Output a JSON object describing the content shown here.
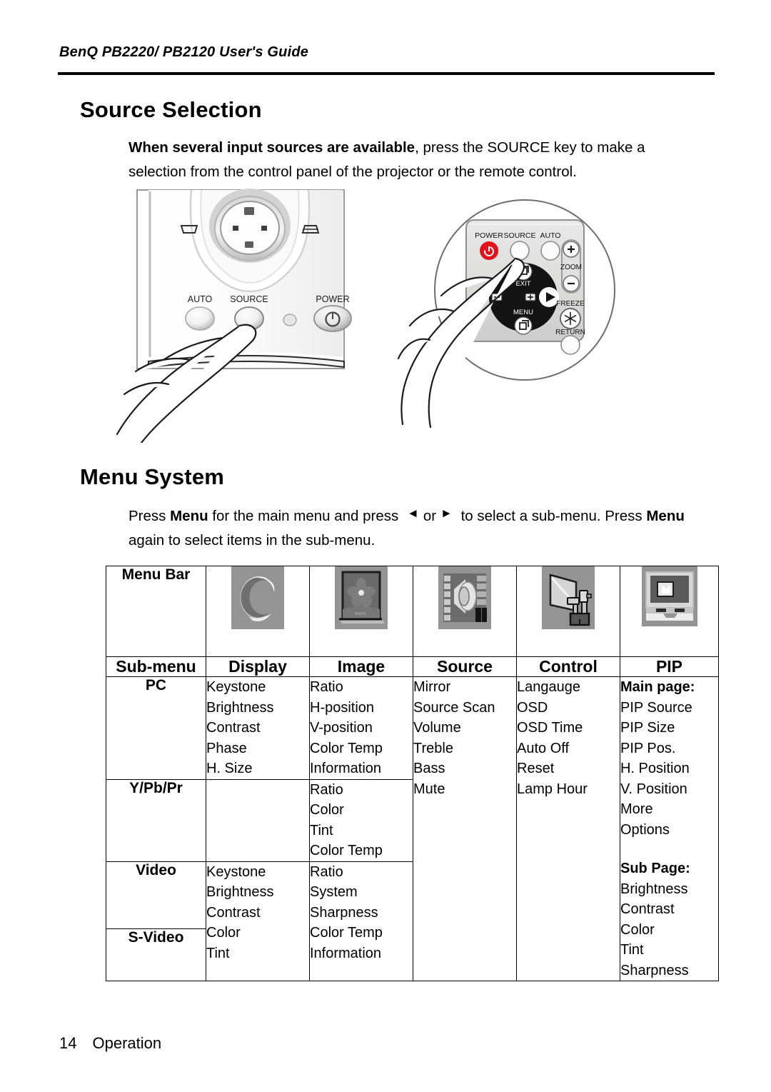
{
  "header": {
    "running_title": "BenQ PB2220/ PB2120 User's Guide"
  },
  "sections": {
    "source_selection": {
      "heading": "Source Selection",
      "paragraph_bold": "When several input sources are available",
      "paragraph_rest": ", press the SOURCE key to make a selection from the control panel of the projector or the remote control."
    },
    "menu_system": {
      "heading": "Menu System",
      "p_part1": "Press ",
      "p_bold1": "Menu",
      "p_part2": " for the main menu and press ",
      "left_arrow": "◄",
      "p_or": "or",
      "right_arrow": "►",
      "p_part3": " to select a sub-menu. Press ",
      "p_bold2": "Menu",
      "p_part4": " again to select items in the sub-menu."
    }
  },
  "illustration": {
    "projector_panel": {
      "auto_label": "AUTO",
      "source_label": "SOURCE",
      "power_label": "POWER"
    },
    "remote": {
      "power_label": "POWER",
      "source_label": "SOURCE",
      "auto_label": "AUTO",
      "zoom_label": "ZOOM",
      "zoom_in": "+",
      "zoom_out": "−",
      "exit_label": "EXIT",
      "freeze_label": "FREEZE",
      "menu_label": "MENU",
      "return_label": "RETURN",
      "power_button_color": "#e3131b"
    }
  },
  "table": {
    "menu_bar_label": "Menu Bar",
    "headers": {
      "sub_menu": "Sub-menu",
      "display": "Display",
      "image": "Image",
      "source": "Source",
      "control": "Control",
      "pip": "PIP"
    },
    "menu_bar_icons": [
      "display-ring-icon",
      "image-picture-frame-icon",
      "source-speaker-film-icon",
      "control-projector-screen-icon",
      "pip-monitor-inset-icon"
    ],
    "rows": {
      "pc": {
        "label": "PC",
        "display": [
          "Keystone",
          "Brightness",
          "Contrast",
          "Phase",
          "H. Size"
        ],
        "image": [
          "Ratio",
          "H-position",
          "V-position",
          "Color Temp",
          "Information"
        ],
        "source": [
          "Mirror",
          "Source Scan",
          "Volume",
          "Treble",
          "Bass",
          "Mute"
        ],
        "control": [
          "Langauge",
          "OSD",
          "OSD Time",
          "Auto Off",
          "Reset",
          "Lamp Hour"
        ]
      },
      "ypbpr": {
        "label": "Y/Pb/Pr",
        "display": [],
        "image": [
          "Ratio",
          "Color",
          "Tint",
          "Color Temp"
        ]
      },
      "video": {
        "label": "Video"
      },
      "svideo": {
        "label": "S-Video"
      },
      "video_group": {
        "display": [
          "Keystone",
          "Brightness",
          "Contrast",
          "Color",
          "Tint"
        ],
        "image": [
          "Ratio",
          "System",
          "Sharpness",
          "Color Temp",
          "Information"
        ]
      },
      "pip_column": {
        "main_page_title": "Main page:",
        "main_page_items": [
          "PIP Source",
          "PIP Size",
          "PIP Pos.",
          "H. Position",
          "V. Position",
          "More",
          "Options"
        ],
        "sub_page_title": "Sub Page:",
        "sub_page_items": [
          "Brightness",
          "Contrast",
          "Color",
          "Tint",
          "Sharpness"
        ]
      }
    }
  },
  "footer": {
    "page_number": "14",
    "section_name": "Operation"
  }
}
